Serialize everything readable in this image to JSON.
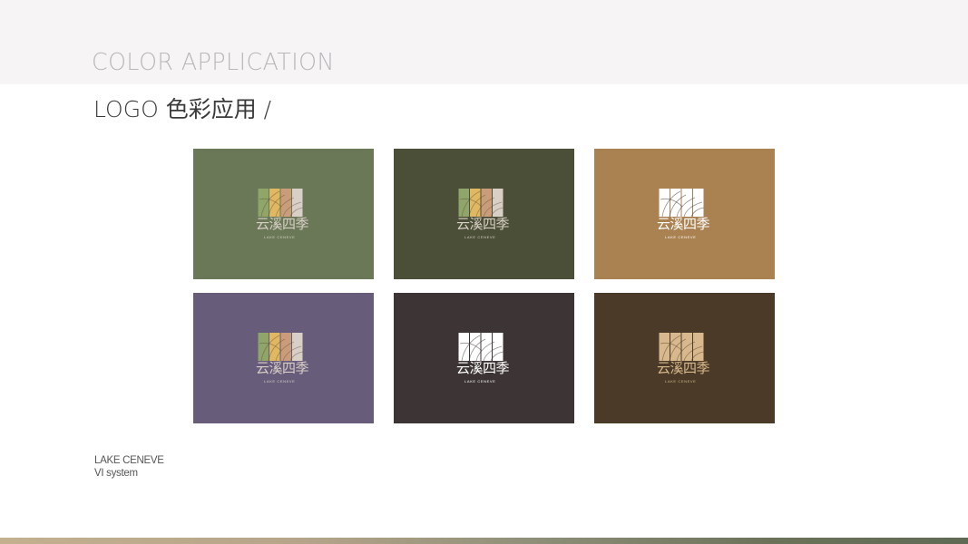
{
  "header": {
    "section_title": "COLOR APPLICATION",
    "subtitle": "LOGO 色彩应用 /"
  },
  "logo": {
    "name_cn": "云溪四季",
    "name_en": "LAKE CENEVE",
    "icon": "four-stripe-curved-lines-mark"
  },
  "cards": [
    {
      "background": "#6a7857",
      "mark_style": "full-color",
      "stripe_colors": [
        "#8fa56a",
        "#e0b862",
        "#c99d79",
        "#d8cfc7"
      ],
      "text_color": "#d8cfc7"
    },
    {
      "background": "#4b4f37",
      "mark_style": "full-color",
      "stripe_colors": [
        "#8fa56a",
        "#e0b862",
        "#c99d79",
        "#d8cfc7"
      ],
      "text_color": "#d8cfc7"
    },
    {
      "background": "#aa8251",
      "mark_style": "white",
      "stripe_colors": [
        "#ffffff",
        "#ffffff",
        "#ffffff",
        "#ffffff"
      ],
      "text_color": "#ffffff"
    },
    {
      "background": "#675c7a",
      "mark_style": "full-color",
      "stripe_colors": [
        "#8fa56a",
        "#e0b862",
        "#c99d79",
        "#d8cfc7"
      ],
      "text_color": "#d8cfc7"
    },
    {
      "background": "#3d3535",
      "mark_style": "white",
      "stripe_colors": [
        "#ffffff",
        "#ffffff",
        "#ffffff",
        "#ffffff"
      ],
      "text_color": "#ffffff"
    },
    {
      "background": "#4a3a27",
      "mark_style": "beige",
      "stripe_colors": [
        "#d8b98d",
        "#d8b98d",
        "#d8b98d",
        "#d8b98d"
      ],
      "text_color": "#d8b98d"
    }
  ],
  "footer": {
    "brand_line": "LAKE CENEVE",
    "system_line": "VI system"
  },
  "colors": {
    "top_band": "#f6f4f5",
    "title_gray": "#b9b7b9",
    "bottom_bar_start": "#c2b08f",
    "bottom_bar_end": "#5f6a55"
  }
}
